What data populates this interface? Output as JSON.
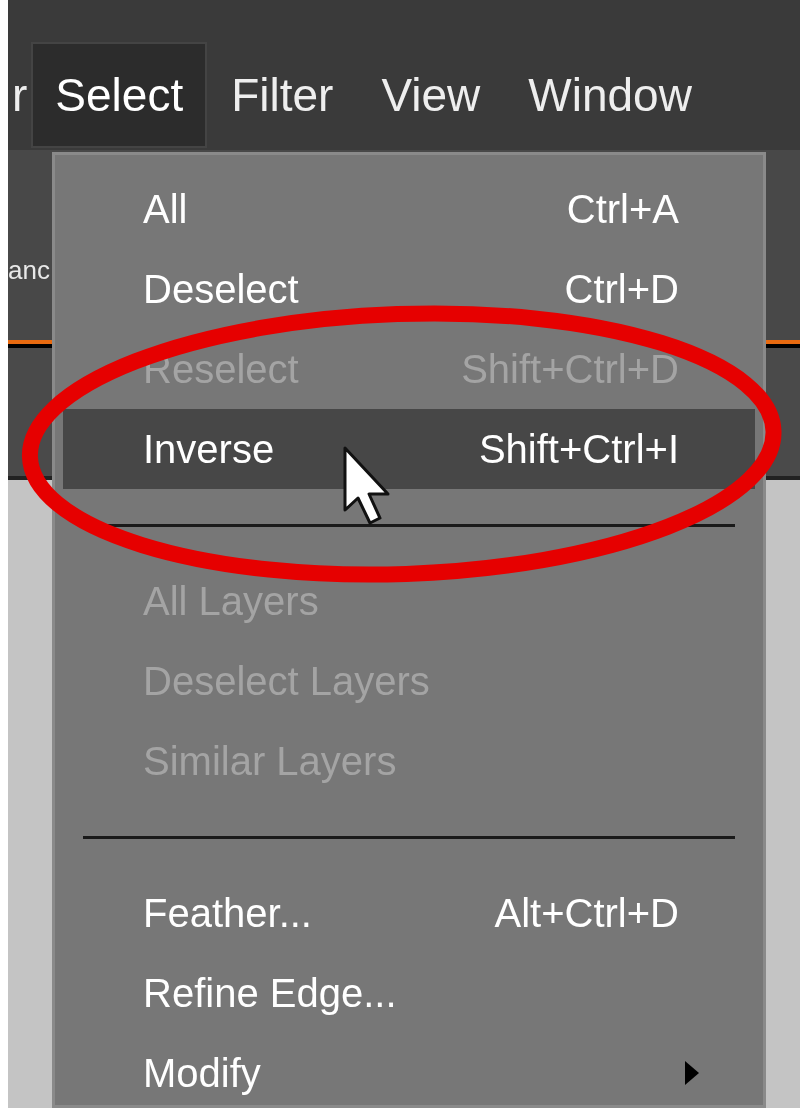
{
  "menu_bar": [
    {
      "label": "r",
      "selected": false
    },
    {
      "label": "Select",
      "selected": true
    },
    {
      "label": "Filter",
      "selected": false
    },
    {
      "label": "View",
      "selected": false
    },
    {
      "label": "Window",
      "selected": false
    }
  ],
  "toolbar": {
    "label": "anc"
  },
  "menu": {
    "items": [
      {
        "kind": "item",
        "label": "All",
        "shortcut": "Ctrl+A",
        "disabled": false,
        "selected": false
      },
      {
        "kind": "item",
        "label": "Deselect",
        "shortcut": "Ctrl+D",
        "disabled": false,
        "selected": false
      },
      {
        "kind": "item",
        "label": "Reselect",
        "shortcut": "Shift+Ctrl+D",
        "disabled": true,
        "selected": false
      },
      {
        "kind": "item",
        "label": "Inverse",
        "shortcut": "Shift+Ctrl+I",
        "disabled": false,
        "selected": true
      },
      {
        "kind": "separator"
      },
      {
        "kind": "item",
        "label": "All Layers",
        "disabled": true,
        "selected": false
      },
      {
        "kind": "item",
        "label": "Deselect Layers",
        "disabled": true,
        "selected": false
      },
      {
        "kind": "item",
        "label": "Similar Layers",
        "disabled": true,
        "selected": false
      },
      {
        "kind": "separator"
      },
      {
        "kind": "item",
        "label": "Feather...",
        "shortcut": "Alt+Ctrl+D",
        "disabled": false,
        "selected": false
      },
      {
        "kind": "item",
        "label": "Refine Edge...",
        "disabled": false,
        "selected": false
      },
      {
        "kind": "item",
        "label": "Modify",
        "disabled": false,
        "selected": false,
        "submenu": true
      }
    ]
  }
}
